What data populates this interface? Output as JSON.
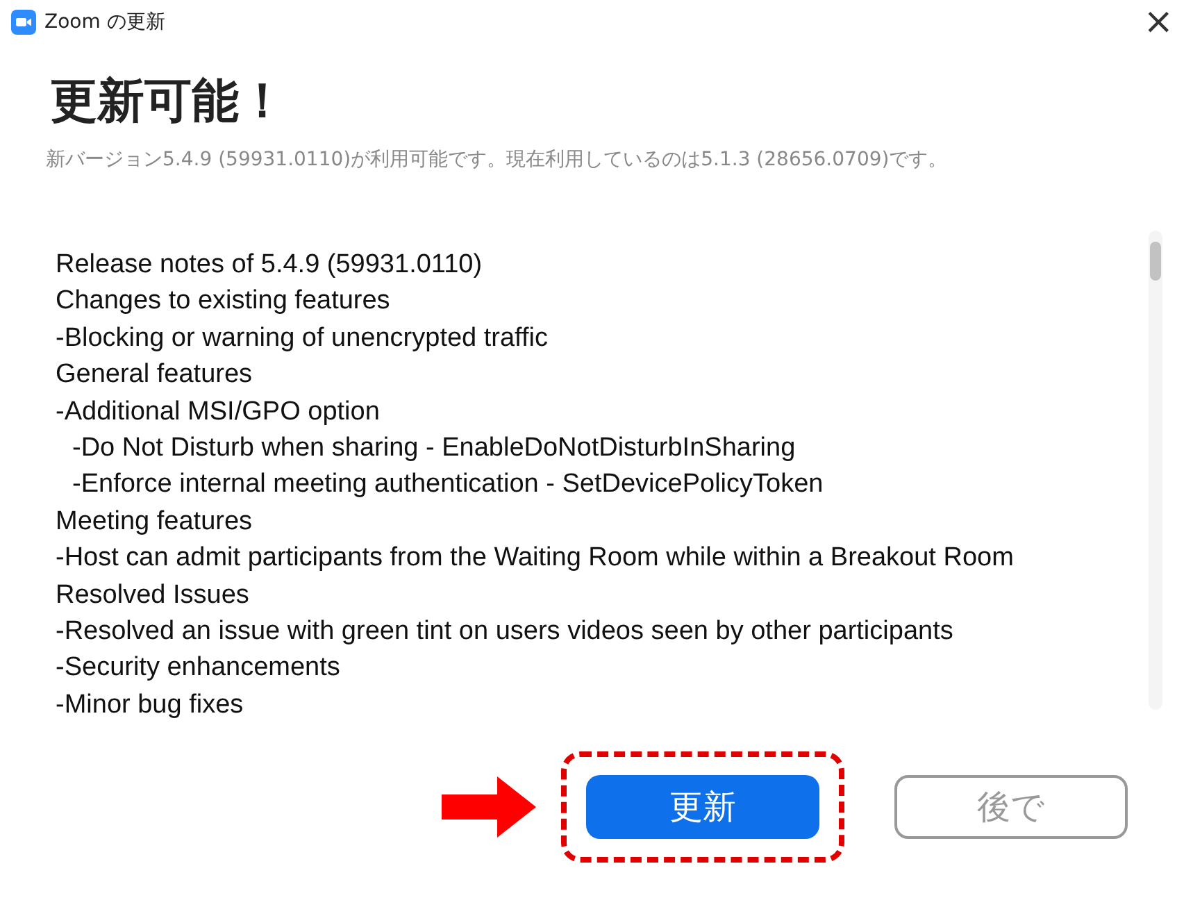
{
  "window": {
    "title": "Zoom の更新",
    "close": "×"
  },
  "heading": "更新可能！",
  "subtitle": "新バージョン5.4.9 (59931.0110)が利用可能です。現在利用しているのは5.1.3 (28656.0709)です。",
  "notes": [
    {
      "text": "Release notes of 5.4.9 (59931.0110)"
    },
    {
      "text": "Changes to existing features"
    },
    {
      "text": "-Blocking or warning of unencrypted traffic"
    },
    {
      "text": "General features"
    },
    {
      "text": "-Additional MSI/GPO option",
      "children": [
        {
          "text": "-Do Not Disturb when sharing - EnableDoNotDisturbInSharing"
        },
        {
          "text": "-Enforce internal meeting authentication - SetDevicePolicyToken"
        }
      ]
    },
    {
      "text": "Meeting features"
    },
    {
      "text": "-Host can admit participants from the Waiting Room while within a Breakout Room"
    },
    {
      "text": "Resolved Issues"
    },
    {
      "text": "-Resolved an issue with green tint on users videos seen by other participants"
    },
    {
      "text": "-Security enhancements"
    },
    {
      "text": "-Minor bug fixes"
    }
  ],
  "buttons": [
    {
      "label": "更新",
      "kind": "primary",
      "highlighted": true
    },
    {
      "label": "後で",
      "kind": "secondary",
      "highlighted": false
    }
  ]
}
